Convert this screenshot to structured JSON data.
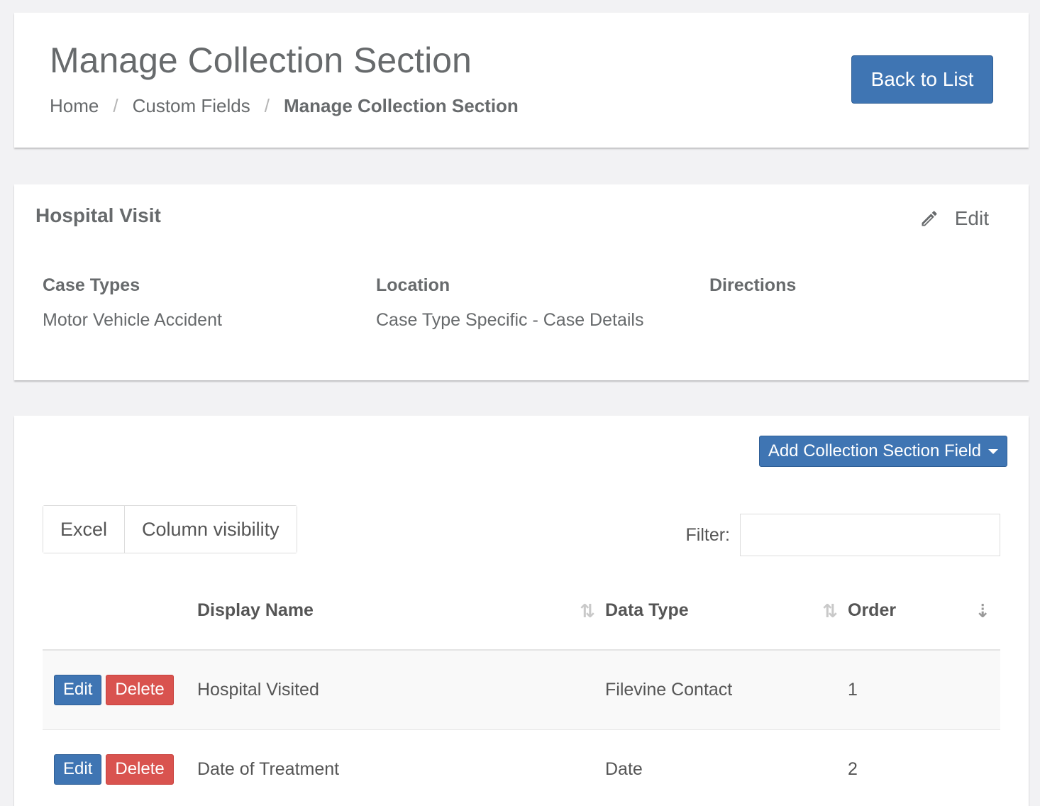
{
  "header": {
    "title": "Manage Collection Section",
    "breadcrumb": [
      "Home",
      "Custom Fields",
      "Manage Collection Section"
    ],
    "breadcrumb_separator": "/",
    "back_button": "Back to List"
  },
  "section": {
    "name": "Hospital Visit",
    "edit_label": "Edit",
    "fields": [
      {
        "label": "Case Types",
        "value": "Motor Vehicle Accident"
      },
      {
        "label": "Location",
        "value": "Case Type Specific - Case Details"
      },
      {
        "label": "Directions",
        "value": ""
      }
    ]
  },
  "table_panel": {
    "add_button": "Add Collection Section Field",
    "buttons": [
      "Excel",
      "Column visibility"
    ],
    "filter_label": "Filter:",
    "filter_value": "",
    "columns": [
      "",
      "Display Name",
      "Data Type",
      "Order"
    ],
    "rows": [
      {
        "edit": "Edit",
        "delete": "Delete",
        "display_name": "Hospital Visited",
        "data_type": "Filevine Contact",
        "order": "1"
      },
      {
        "edit": "Edit",
        "delete": "Delete",
        "display_name": "Date of Treatment",
        "data_type": "Date",
        "order": "2"
      }
    ]
  },
  "colors": {
    "primary": "#3f75b3",
    "danger": "#d9534f",
    "background": "#f2f2f4"
  },
  "icons": {
    "edit": "pencil-icon",
    "sort": "sort-both-icon",
    "sort_active": "sort-numeric-asc-icon",
    "dropdown": "caret-down-icon"
  }
}
